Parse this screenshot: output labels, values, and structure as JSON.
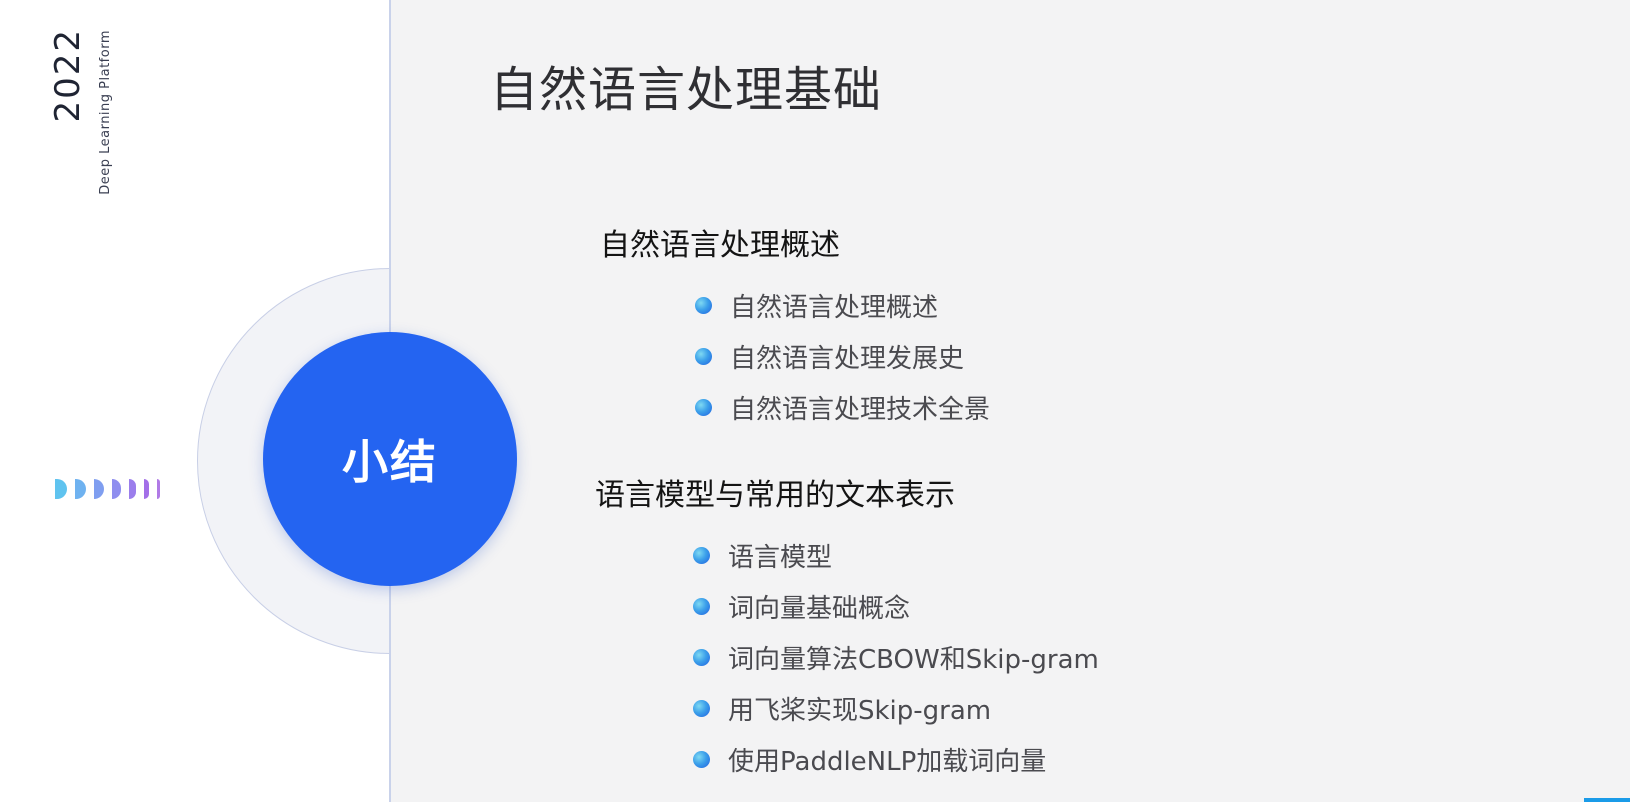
{
  "sidebar": {
    "year": "2022",
    "platform": "Deep Learning Platform"
  },
  "summary": {
    "label": "小结"
  },
  "slide": {
    "title": "自然语言处理基础"
  },
  "sections": [
    {
      "heading": "自然语言处理概述",
      "items": [
        "自然语言处理概述",
        "自然语言处理发展史",
        "自然语言处理技术全景"
      ]
    },
    {
      "heading": "语言模型与常用的文本表示",
      "items": [
        "语言模型",
        "词向量基础概念",
        "词向量算法CBOW和Skip-gram",
        "用飞桨实现Skip-gram",
        "使用PaddleNLP加载词向量"
      ]
    }
  ],
  "colors": {
    "accent": "#2464f1",
    "bullet": "#3ca0ea",
    "chevrons": [
      "#5fc3ef",
      "#6fb2f0",
      "#7f9ef0",
      "#8f8eef",
      "#9b7eec",
      "#a36fe8",
      "#b07ae6"
    ]
  }
}
